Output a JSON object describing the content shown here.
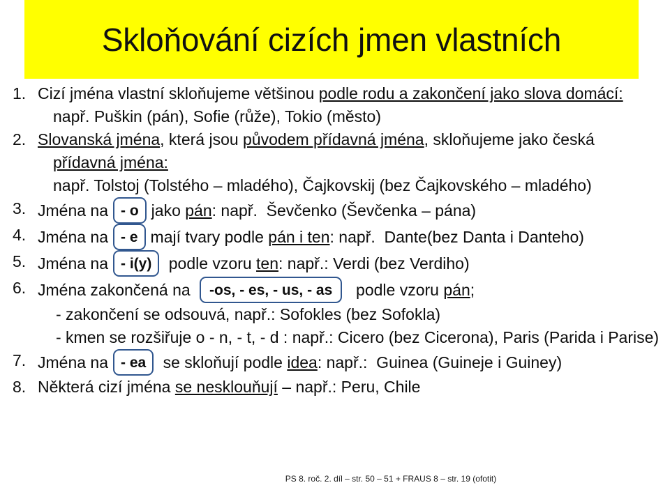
{
  "slide": {
    "title": "Skloňování cizích jmen vlastních",
    "banner_color": "#ffff00",
    "box_border_color": "#31578f"
  },
  "items": [
    {
      "number": "1.",
      "lines": [
        {
          "parts": [
            {
              "text": "Cizí jména vlastní skloňujeme většinou "
            },
            {
              "text": "podle rodu a zakončení jako slova domácí:",
              "underline": true
            }
          ]
        },
        {
          "indent": 1,
          "parts": [
            {
              "text": "např. Puškin (pán),  Sofie (růže), Tokio (město)"
            }
          ]
        }
      ]
    },
    {
      "number": "2.",
      "lines": [
        {
          "parts": [
            {
              "text": "Slovanská jména",
              "underline": true
            },
            {
              "text": ", která jsou "
            },
            {
              "text": "původem přídavná jména",
              "underline": true
            },
            {
              "text": ", skloňujeme jako česká"
            }
          ]
        },
        {
          "indent": 1,
          "parts": [
            {
              "text": "přídavná jména:",
              "underline": true
            }
          ]
        },
        {
          "indent": 1,
          "parts": [
            {
              "text": "např. Tolstoj (Tolstého – mladého), Čajkovskij (bez Čajkovského – mladého)"
            }
          ]
        }
      ]
    },
    {
      "number": "3.",
      "lines": [
        {
          "box_line": true,
          "segments": [
            {
              "type": "text",
              "text": "Jména na"
            },
            {
              "type": "box",
              "text": "- o"
            },
            {
              "type": "text",
              "text": "jako "
            },
            {
              "type": "text",
              "text": "pán",
              "underline": true
            },
            {
              "type": "text",
              "text": ": např.  Ševčenko (Ševčenka – pána)"
            }
          ]
        }
      ]
    },
    {
      "number": "4.",
      "lines": [
        {
          "box_line": true,
          "segments": [
            {
              "type": "text",
              "text": "Jména na"
            },
            {
              "type": "box",
              "text": "- e"
            },
            {
              "type": "text",
              "text": "mají tvary podle "
            },
            {
              "type": "text",
              "text": "pán i ten",
              "underline": true
            },
            {
              "type": "text",
              "text": ": např.  Dante(bez Danta i Danteho)"
            }
          ]
        }
      ]
    },
    {
      "number": "5.",
      "lines": [
        {
          "box_line": true,
          "segments": [
            {
              "type": "text",
              "text": "Jména na"
            },
            {
              "type": "box",
              "text": "- i(y)"
            },
            {
              "type": "text",
              "text": " podle vzoru "
            },
            {
              "type": "text",
              "text": "ten",
              "underline": true
            },
            {
              "type": "text",
              "text": ": např.: Verdi (bez Verdiho)"
            }
          ]
        }
      ]
    },
    {
      "number": "6.",
      "lines": [
        {
          "box_line": true,
          "segments": [
            {
              "type": "text",
              "text": "Jména zakončená na "
            },
            {
              "type": "box",
              "text": "-os, - es, - us, - as",
              "wide": true
            },
            {
              "type": "text",
              "text": "  podle vzoru "
            },
            {
              "type": "text",
              "text": "pán",
              "underline": true
            },
            {
              "type": "text",
              "text": ";"
            }
          ]
        },
        {
          "indent": 2,
          "parts": [
            {
              "text": "- zakončení se odsouvá, např.: Sofokles (bez Sofokla)"
            }
          ]
        },
        {
          "indent": 2,
          "parts": [
            {
              "text": "- kmen se rozšiřuje o   - n, - t, - d  : např.: Cicero (bez Cicerona), Paris (Parida i Parise)"
            }
          ]
        }
      ]
    },
    {
      "number": "7.",
      "lines": [
        {
          "box_line": true,
          "segments": [
            {
              "type": "text",
              "text": "Jména na"
            },
            {
              "type": "box",
              "text": "- ea"
            },
            {
              "type": "text",
              "text": " se skloňují podle "
            },
            {
              "type": "text",
              "text": "idea",
              "underline": true
            },
            {
              "type": "text",
              "text": ": např.:  Guinea (Guineje i Guiney)"
            }
          ]
        }
      ]
    },
    {
      "number": "8.",
      "lines": [
        {
          "parts": [
            {
              "text": "Některá cizí jména "
            },
            {
              "text": "se nesklouňují",
              "underline": true
            },
            {
              "text": " – např.: Peru, Chile"
            }
          ]
        }
      ]
    }
  ],
  "footer": {
    "text": "PS 8. roč. 2. díl – str. 50 – 51 + FRAUS 8 – str. 19 (ofotit)"
  }
}
